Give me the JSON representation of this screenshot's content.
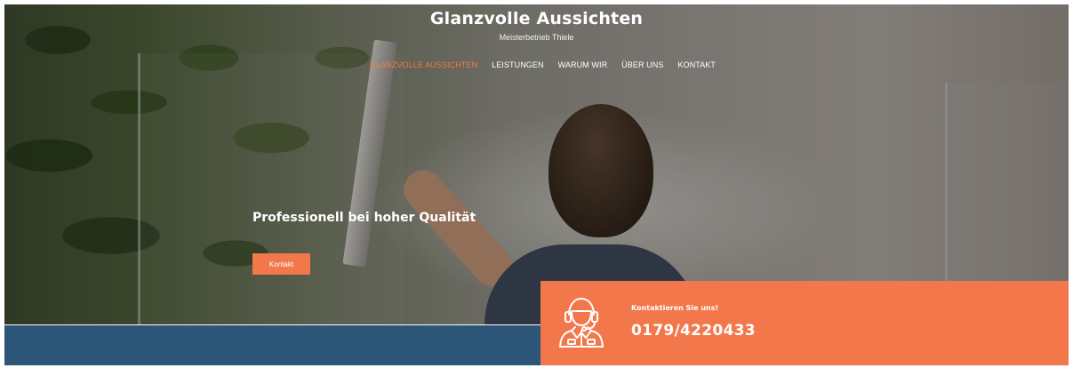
{
  "header": {
    "site_title": "Glanzvolle Aussichten",
    "tagline": "Meisterbetrieb Thiele"
  },
  "nav": {
    "items": [
      {
        "label": "GLANZVOLLE AUSSICHTEN",
        "active": true
      },
      {
        "label": "LEISTUNGEN",
        "active": false
      },
      {
        "label": "WARUM WIR",
        "active": false
      },
      {
        "label": "ÜBER UNS",
        "active": false
      },
      {
        "label": "KONTAKT",
        "active": false
      }
    ]
  },
  "hero": {
    "heading": "Professionell bei hoher Qualität",
    "cta_label": "Kontakt"
  },
  "contact": {
    "label": "Kontaktieren Sie uns!",
    "phone": "0179/4220433",
    "icon": "support-agent-headset-icon"
  },
  "colors": {
    "accent": "#f2784b",
    "band": "#2d5577",
    "text_light": "#ffffff"
  }
}
